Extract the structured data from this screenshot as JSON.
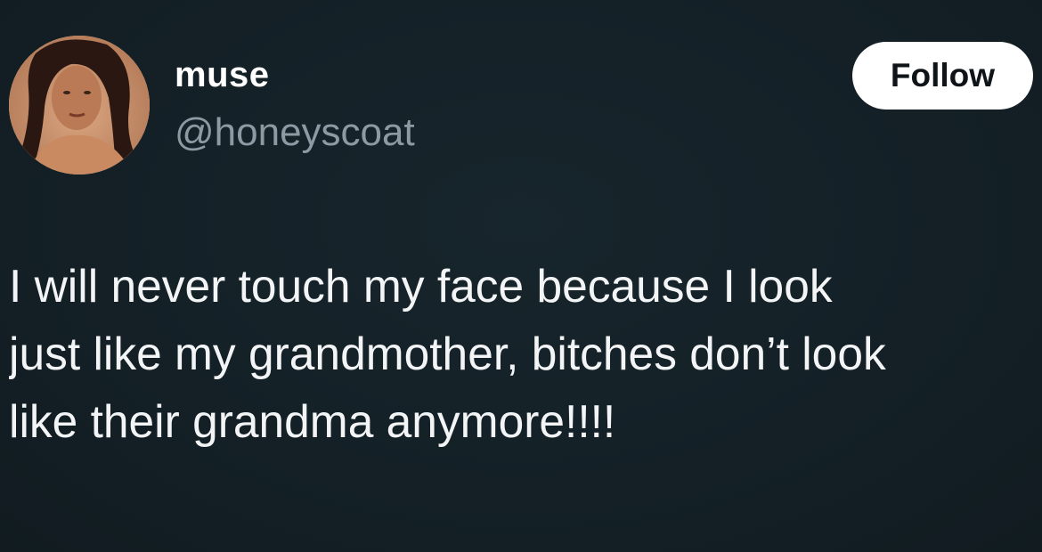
{
  "user": {
    "display_name": "muse",
    "handle": "@honeyscoat",
    "avatar_icon": "profile-photo"
  },
  "follow_button": {
    "label": "Follow"
  },
  "tweet": {
    "lines": [
      "I will never touch my face because I look",
      "just like my grandmother, bitches don’t look",
      "like their grandma anymore!!!!"
    ]
  },
  "colors": {
    "background": "#152127",
    "text_primary": "#ffffff",
    "text_secondary": "#8e9aa3",
    "button_bg": "#ffffff",
    "button_text": "#0f1419"
  }
}
